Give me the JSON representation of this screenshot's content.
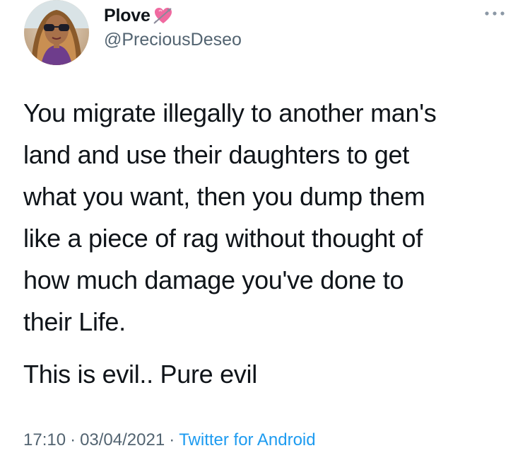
{
  "author": {
    "display_name": "Plove",
    "emoji_icon": "heart-with-arrow-icon",
    "handle": "@PreciousDeseo"
  },
  "tweet": {
    "paragraph_1": "You migrate illegally to another man's\nland and use their daughters to get\nwhat you want, then you dump them\nlike a piece of rag without thought of\nhow much damage you've done to\ntheir Life.",
    "paragraph_2": "This is evil.. Pure evil"
  },
  "meta": {
    "time": "17:10",
    "date": "03/04/2021",
    "separator": "·",
    "source": "Twitter for Android"
  },
  "colors": {
    "text": "#0f1419",
    "secondary": "#536471",
    "link": "#1d9bf0",
    "heart": "#f06aa0"
  }
}
